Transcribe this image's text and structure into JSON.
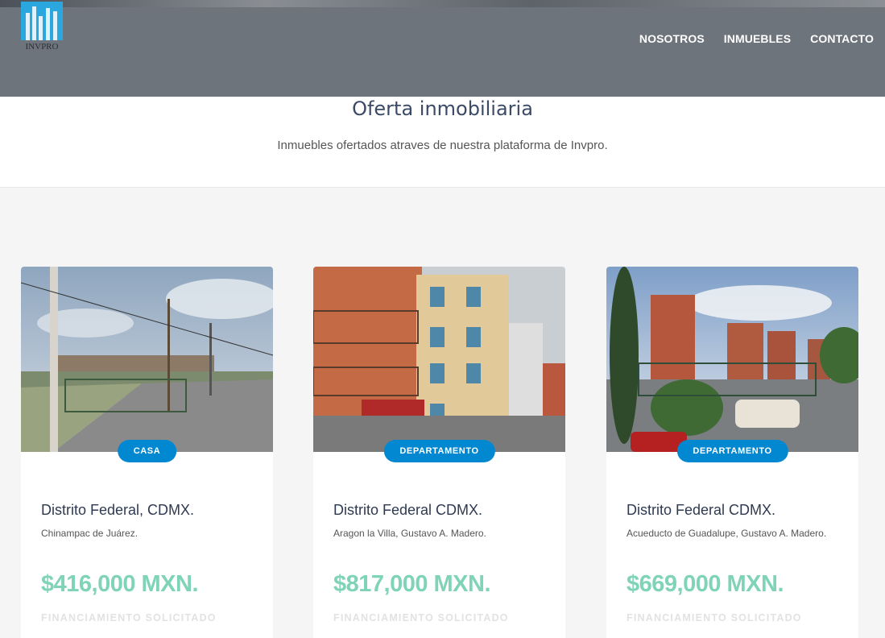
{
  "brand": {
    "name": "INVPRO"
  },
  "nav": {
    "items": [
      "NOSOTROS",
      "INMUEBLES",
      "CONTACTO"
    ]
  },
  "intro": {
    "title": "Oferta inmobiliaria",
    "subtitle": "Inmuebles ofertados atraves de nuestra plataforma de Invpro."
  },
  "colors": {
    "accent": "#0288d1",
    "price": "#7fd3b6",
    "header": "#6d747c"
  },
  "listings": [
    {
      "type": "CASA",
      "title": "Distrito Federal, CDMX.",
      "location": "Chinampac de Juárez.",
      "price": "$416,000 MXN.",
      "status": "FINANCIAMIENTO SOLICITADO"
    },
    {
      "type": "DEPARTAMENTO",
      "title": "Distrito Federal CDMX.",
      "location": "Aragon la Villa, Gustavo A. Madero.",
      "price": "$817,000 MXN.",
      "status": "FINANCIAMIENTO SOLICITADO"
    },
    {
      "type": "DEPARTAMENTO",
      "title": "Distrito Federal CDMX.",
      "location": "Acueducto de Guadalupe, Gustavo A. Madero.",
      "price": "$669,000 MXN.",
      "status": "FINANCIAMIENTO SOLICITADO"
    }
  ]
}
